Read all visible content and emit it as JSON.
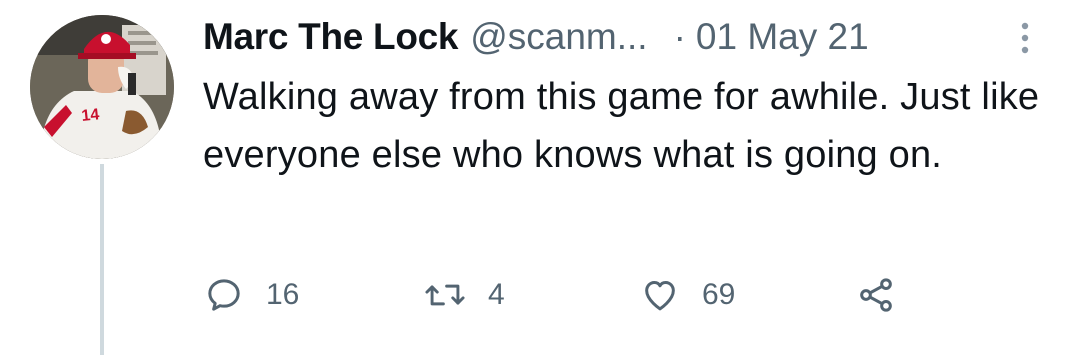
{
  "tweet": {
    "author_name": "Marc The Lock",
    "author_handle": "@scanm...",
    "separator": "·",
    "date": "01 May 21",
    "text": "Walking away from this game for awhile. Just like everyone else who knows what is going on.",
    "avatar_number": "14"
  },
  "actions": {
    "reply_count": "16",
    "retweet_count": "4",
    "like_count": "69"
  },
  "icons": {
    "reply": "reply-icon",
    "retweet": "retweet-icon",
    "like": "heart-icon",
    "share": "share-icon",
    "more": "more-options-icon"
  },
  "colors": {
    "text_primary": "#0f1419",
    "text_secondary": "#536471",
    "thread_line": "#cfd9de"
  }
}
